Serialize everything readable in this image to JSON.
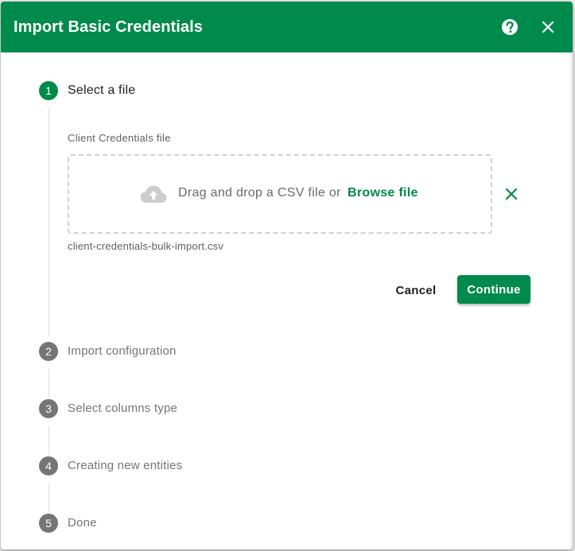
{
  "dialog": {
    "title": "Import Basic Credentials",
    "help_icon": "help-circle-icon",
    "close_icon": "close-icon",
    "header_color": "#008a4b"
  },
  "stepper": {
    "steps": [
      {
        "number": "1",
        "label": "Select a file",
        "state": "active"
      },
      {
        "number": "2",
        "label": "Import configuration",
        "state": "inactive"
      },
      {
        "number": "3",
        "label": "Select columns type",
        "state": "inactive"
      },
      {
        "number": "4",
        "label": "Creating new entities",
        "state": "inactive"
      },
      {
        "number": "5",
        "label": "Done",
        "state": "inactive"
      }
    ]
  },
  "file_step": {
    "field_label": "Client Credentials file",
    "dropzone_icon": "cloud-upload-icon",
    "drop_text": "Drag and drop a CSV file or",
    "browse_label": "Browse file",
    "clear_icon": "clear-icon",
    "selected_file": "client-credentials-bulk-import.csv",
    "cancel_label": "Cancel",
    "continue_label": "Continue"
  },
  "colors": {
    "accent": "#008a4b",
    "inactive_step": "#757575"
  }
}
